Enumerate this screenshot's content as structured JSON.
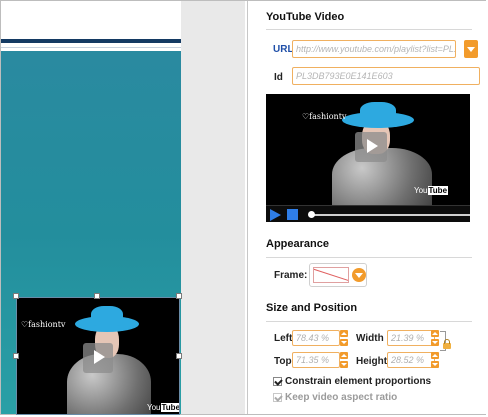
{
  "panel": {
    "title": "YouTube Video",
    "url_label": "URL",
    "url_value": "http://www.youtube.com/playlist?list=PL...",
    "id_label": "Id",
    "id_value": "PL3DB793E0E141E603",
    "appearance_heading": "Appearance",
    "frame_label": "Frame:",
    "size_heading": "Size and Position",
    "left_label": "Left",
    "left_value": "78.43 %",
    "width_label": "Width",
    "width_value": "21.39 %",
    "top_label": "Top",
    "top_value": "71.35 %",
    "height_label": "Height",
    "height_value": "28.52 %",
    "constrain_label": "Constrain element proportions",
    "constrain_checked": true,
    "keep_aspect_label": "Keep video aspect ratio",
    "keep_aspect_checked": true
  },
  "video": {
    "channel_logo": "fashiontv",
    "youtube_logo_you": "You",
    "youtube_logo_tube": "Tube"
  },
  "colors": {
    "accent_orange": "#f29b2b",
    "teal_background": "#2a8aa0",
    "navy_bar": "#143a63",
    "hat_blue": "#2da9e0",
    "player_blue": "#2f7ee8"
  }
}
